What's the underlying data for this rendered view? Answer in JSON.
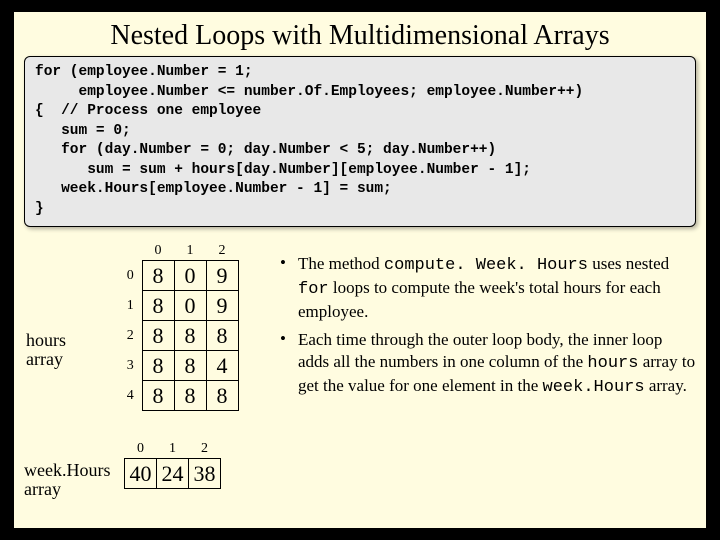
{
  "title": "Nested Loops with Multidimensional Arrays",
  "code": "for (employee.Number = 1;\n     employee.Number <= number.Of.Employees; employee.Number++)\n{  // Process one employee\n   sum = 0;\n   for (day.Number = 0; day.Number < 5; day.Number++)\n      sum = sum + hours[day.Number][employee.Number - 1];\n   week.Hours[employee.Number - 1] = sum;\n}",
  "labels": {
    "hours": "hours array",
    "week": "week.Hours array"
  },
  "hours": {
    "cols": [
      "0",
      "1",
      "2"
    ],
    "rows": [
      "0",
      "1",
      "2",
      "3",
      "4"
    ],
    "data": [
      [
        "8",
        "0",
        "9"
      ],
      [
        "8",
        "0",
        "9"
      ],
      [
        "8",
        "8",
        "8"
      ],
      [
        "8",
        "8",
        "4"
      ],
      [
        "8",
        "8",
        "8"
      ]
    ]
  },
  "week": {
    "cols": [
      "0",
      "1",
      "2"
    ],
    "data": [
      "40",
      "24",
      "38"
    ]
  },
  "bullets": {
    "b1a": "The method ",
    "b1m": "compute. Week. Hours",
    "b1b": " uses nested ",
    "b1m2": "for",
    "b1c": " loops to compute the week's total hours for each employee.",
    "b2a": "Each time through the outer loop body, the inner loop adds all the numbers in one column of the ",
    "b2m": "hours",
    "b2b": " array to get the value for one element in the ",
    "b2m2": "week.Hours",
    "b2c": " array."
  }
}
